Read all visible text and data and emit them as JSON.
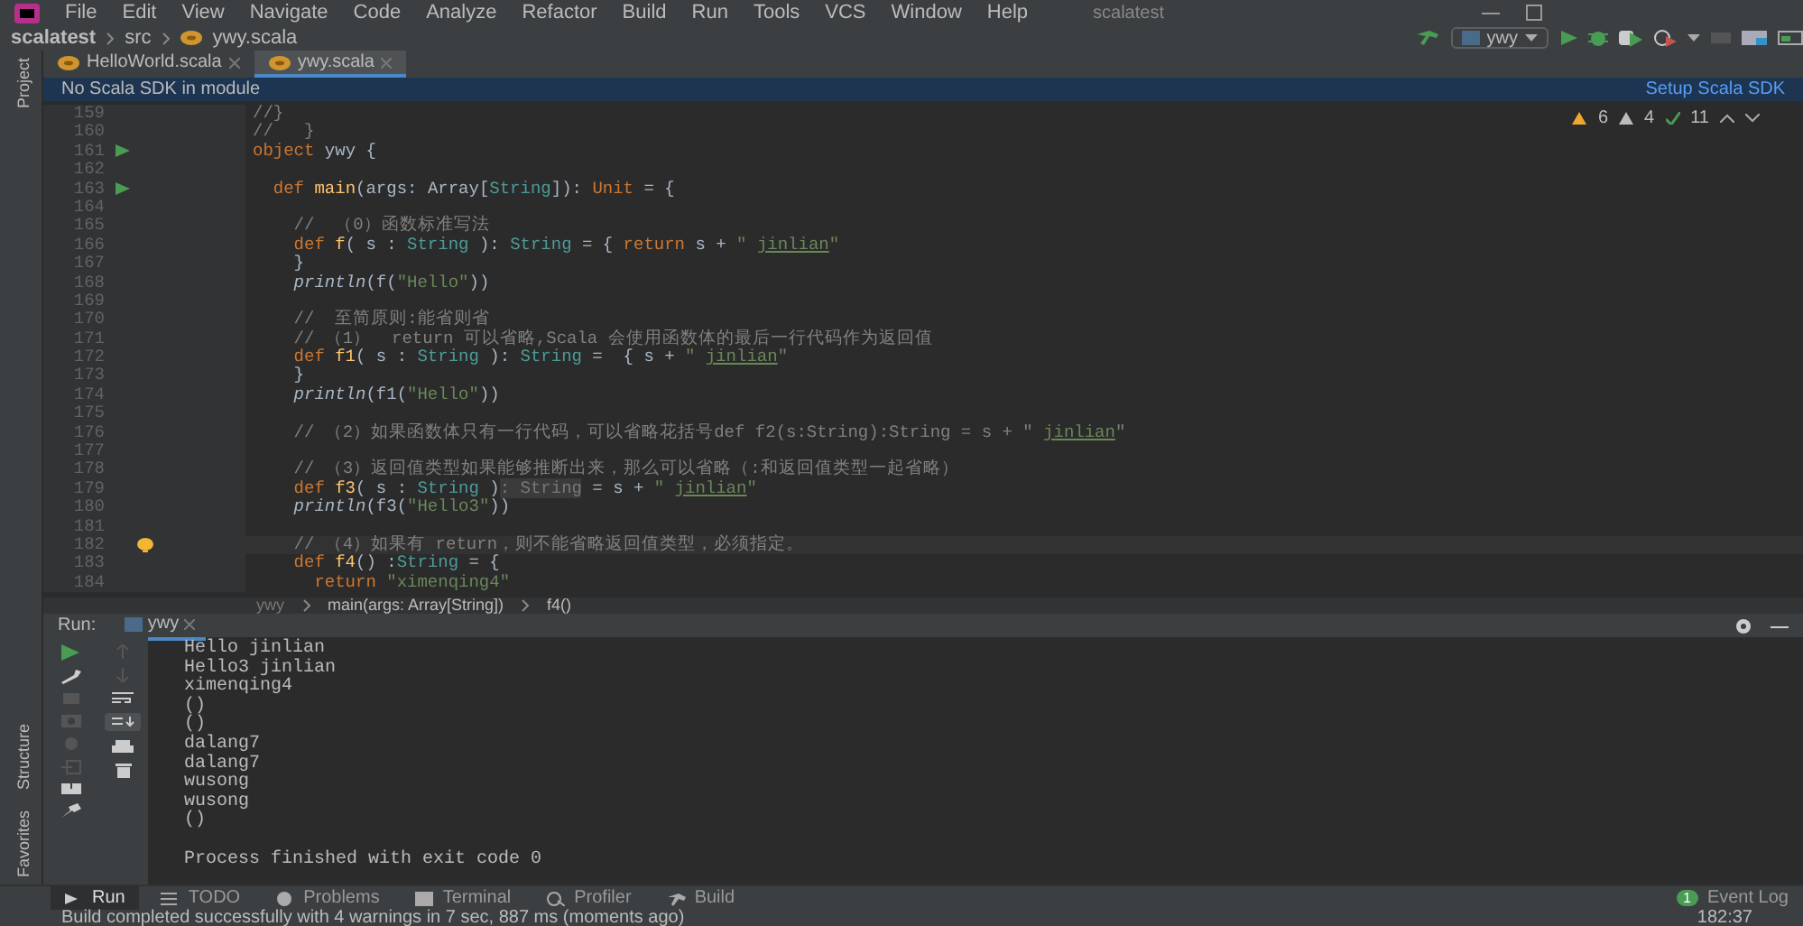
{
  "menu": {
    "items": [
      "File",
      "Edit",
      "View",
      "Navigate",
      "Code",
      "Analyze",
      "Refactor",
      "Build",
      "Run",
      "Tools",
      "VCS",
      "Window",
      "Help"
    ],
    "title": "scalatest"
  },
  "breadcrumb": [
    "scalatest",
    "src",
    "ywy.scala"
  ],
  "run_config": "ywy",
  "side_tools": {
    "top": [
      "Project"
    ],
    "bottom": [
      "Structure",
      "Favorites"
    ]
  },
  "tabs": [
    {
      "label": "HelloWorld.scala",
      "selected": false
    },
    {
      "label": "ywy.scala",
      "selected": true
    }
  ],
  "banner": {
    "message": "No Scala SDK in module",
    "action": "Setup Scala SDK"
  },
  "inspections": {
    "warnings": "6",
    "weak_warnings": "4",
    "typos": "11"
  },
  "code": [
    {
      "number": "159",
      "tokens": [
        {
          "kind": "comment",
          "text": "//}"
        }
      ]
    },
    {
      "number": "160",
      "tokens": [
        {
          "kind": "comment",
          "text": "//   }"
        }
      ]
    },
    {
      "number": "161",
      "run": true,
      "tokens": [
        {
          "kind": "kw",
          "text": "object"
        },
        {
          "kind": "plain",
          "text": " ywy {"
        }
      ]
    },
    {
      "number": "162"
    },
    {
      "number": "163",
      "run": true,
      "tokens": [
        {
          "kind": "kw",
          "text": "  def "
        },
        {
          "kind": "fn",
          "text": "main"
        },
        {
          "kind": "plain",
          "text": "(args: Array["
        },
        {
          "kind": "type",
          "text": "String"
        },
        {
          "kind": "plain",
          "text": "]): "
        },
        {
          "kind": "kw",
          "text": "Unit"
        },
        {
          "kind": "plain",
          "text": " = {"
        }
      ]
    },
    {
      "number": "164"
    },
    {
      "number": "165",
      "tokens": [
        {
          "kind": "comment",
          "text": "    //  （0）函数标准写法"
        }
      ]
    },
    {
      "number": "166",
      "tokens": [
        {
          "kind": "kw",
          "text": "    def "
        },
        {
          "kind": "fn",
          "text": "f"
        },
        {
          "kind": "plain",
          "text": "( s : "
        },
        {
          "kind": "type",
          "text": "String"
        },
        {
          "kind": "plain",
          "text": " ): "
        },
        {
          "kind": "type",
          "text": "String"
        },
        {
          "kind": "plain",
          "text": " = { "
        },
        {
          "kind": "kw",
          "text": "return"
        },
        {
          "kind": "plain",
          "text": " s + "
        },
        {
          "kind": "str",
          "text": "\" "
        },
        {
          "kind": "typo",
          "text": "jinlian"
        },
        {
          "kind": "str",
          "text": "\""
        }
      ]
    },
    {
      "number": "167",
      "tokens": [
        {
          "kind": "plain",
          "text": "    }"
        }
      ]
    },
    {
      "number": "168",
      "tokens": [
        {
          "kind": "call",
          "text": "    println"
        },
        {
          "kind": "plain",
          "text": "(f("
        },
        {
          "kind": "str",
          "text": "\"Hello\""
        },
        {
          "kind": "plain",
          "text": "))"
        }
      ]
    },
    {
      "number": "169"
    },
    {
      "number": "170",
      "tokens": [
        {
          "kind": "comment",
          "text": "    //  至简原则:能省则省"
        }
      ]
    },
    {
      "number": "171",
      "tokens": [
        {
          "kind": "comment",
          "text": "    // （1）  return 可以省略,Scala 会使用函数体的最后一行代码作为返回值"
        }
      ]
    },
    {
      "number": "172",
      "tokens": [
        {
          "kind": "kw",
          "text": "    def "
        },
        {
          "kind": "fn",
          "text": "f1"
        },
        {
          "kind": "plain",
          "text": "( s : "
        },
        {
          "kind": "type",
          "text": "String"
        },
        {
          "kind": "plain",
          "text": " ): "
        },
        {
          "kind": "type",
          "text": "String"
        },
        {
          "kind": "plain",
          "text": " =  { s + "
        },
        {
          "kind": "str",
          "text": "\" "
        },
        {
          "kind": "typo",
          "text": "jinlian"
        },
        {
          "kind": "str",
          "text": "\""
        }
      ]
    },
    {
      "number": "173",
      "tokens": [
        {
          "kind": "plain",
          "text": "    }"
        }
      ]
    },
    {
      "number": "174",
      "tokens": [
        {
          "kind": "call",
          "text": "    println"
        },
        {
          "kind": "plain",
          "text": "(f1("
        },
        {
          "kind": "str",
          "text": "\"Hello\""
        },
        {
          "kind": "plain",
          "text": "))"
        }
      ]
    },
    {
      "number": "175"
    },
    {
      "number": "176",
      "tokens": [
        {
          "kind": "comment",
          "text": "    // （2）如果函数体只有一行代码，可以省略花括号def f2(s:String):String = s + \" "
        },
        {
          "kind": "typo",
          "text": "jinlian"
        },
        {
          "kind": "comment",
          "text": "\""
        }
      ]
    },
    {
      "number": "177"
    },
    {
      "number": "178",
      "tokens": [
        {
          "kind": "comment",
          "text": "    // （3）返回值类型如果能够推断出来，那么可以省略（:和返回值类型一起省略）"
        }
      ]
    },
    {
      "number": "179",
      "tokens": [
        {
          "kind": "kw",
          "text": "    def "
        },
        {
          "kind": "fn",
          "text": "f3"
        },
        {
          "kind": "plain",
          "text": "( s : "
        },
        {
          "kind": "type",
          "text": "String"
        },
        {
          "kind": "plain",
          "text": " )"
        },
        {
          "kind": "hint",
          "text": ": String"
        },
        {
          "kind": "plain",
          "text": " = s + "
        },
        {
          "kind": "str",
          "text": "\" "
        },
        {
          "kind": "typo",
          "text": "jinlian"
        },
        {
          "kind": "str",
          "text": "\""
        }
      ]
    },
    {
      "number": "180",
      "tokens": [
        {
          "kind": "call",
          "text": "    println"
        },
        {
          "kind": "plain",
          "text": "(f3("
        },
        {
          "kind": "str",
          "text": "\"Hello3\""
        },
        {
          "kind": "plain",
          "text": "))"
        }
      ]
    },
    {
      "number": "181"
    },
    {
      "number": "182",
      "bulb": true,
      "current": true,
      "tokens": [
        {
          "kind": "comment",
          "text": "    // （4）如果有 return，则不能省略返回值类型，必须指定。"
        }
      ]
    },
    {
      "number": "183",
      "tokens": [
        {
          "kind": "kw",
          "text": "    def "
        },
        {
          "kind": "fn",
          "text": "f4"
        },
        {
          "kind": "plain",
          "text": "() :"
        },
        {
          "kind": "type",
          "text": "String"
        },
        {
          "kind": "plain",
          "text": " = {"
        }
      ]
    },
    {
      "number": "184",
      "tokens": [
        {
          "kind": "kw",
          "text": "      return "
        },
        {
          "kind": "str",
          "text": "\"ximenqing4\""
        }
      ]
    }
  ],
  "editor_breadcrumb": [
    "ywy",
    "main(args: Array[String])",
    "f4()"
  ],
  "run_panel": {
    "label": "Run:",
    "tab": "ywy",
    "output": [
      "Hello jinlian",
      "Hello3 jinlian",
      "ximenqing4",
      "()",
      "()",
      "dalang7",
      "dalang7",
      "wusong",
      "wusong",
      "()"
    ],
    "exit_message": "Process finished with exit code 0"
  },
  "tool_tabs": [
    {
      "label": "Run",
      "selected": true
    },
    {
      "label": "TODO",
      "selected": false
    },
    {
      "label": "Problems",
      "selected": false
    },
    {
      "label": "Terminal",
      "selected": false
    },
    {
      "label": "Profiler",
      "selected": false
    },
    {
      "label": "Build",
      "selected": false
    }
  ],
  "event_log": {
    "count": "1",
    "label": "Event Log"
  },
  "status_bar": {
    "message": "Build completed successfully with 4 warnings in 7 sec, 887 ms (moments ago)",
    "position": "182:37"
  }
}
